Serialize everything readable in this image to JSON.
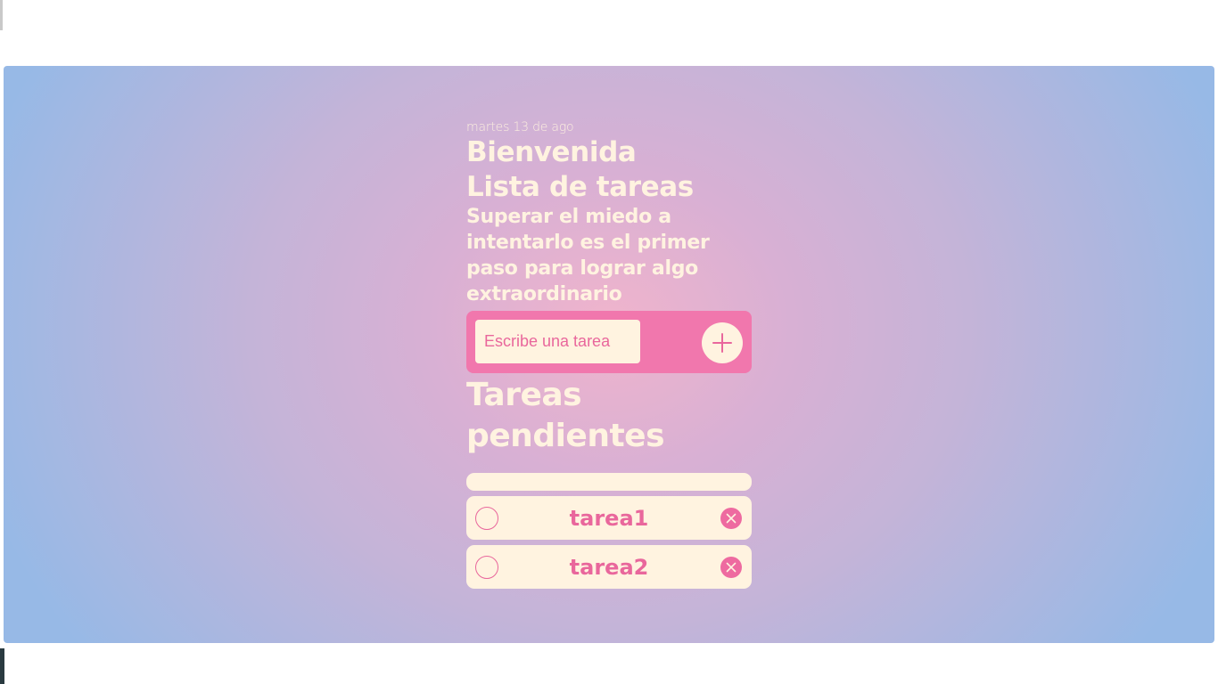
{
  "header": {
    "date": "martes 13 de ago",
    "greeting": "Bienvenida",
    "list_title": "Lista de tareas",
    "quote": "Superar el miedo a intentarlo es el primer paso para lograr algo extraordinario"
  },
  "input": {
    "placeholder": "Escribe una tarea",
    "value": "",
    "add_icon": "plus-icon"
  },
  "pending": {
    "title": "Tareas pendientes",
    "tasks": [
      {
        "label": "tarea1",
        "completed": false
      },
      {
        "label": "tarea2",
        "completed": false
      }
    ]
  },
  "colors": {
    "accent": "#f177ad",
    "text_light": "#fff3e0",
    "text_pink": "#e9679c",
    "gradient_center": "#f0b4cc",
    "gradient_edge": "#97b9e6"
  }
}
